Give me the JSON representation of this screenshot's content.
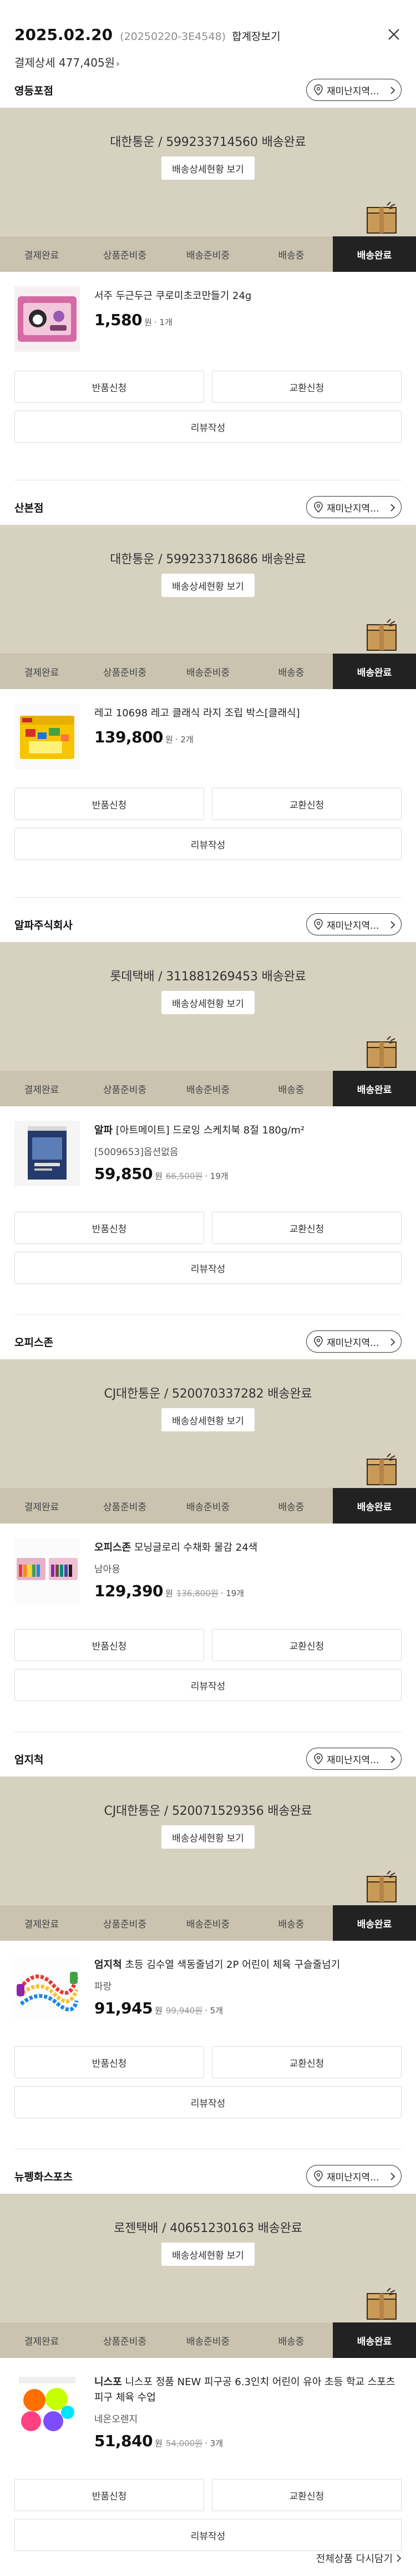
{
  "header": {
    "date": "2025.02.20",
    "order_id": "(20250220-3E4548)",
    "combined_label": "합계장보기",
    "total": "결제상세 477,405원"
  },
  "steps": [
    "결제완료",
    "상품준비중",
    "배송준비중",
    "배송중",
    "배송완료"
  ],
  "pickup_label": "재미난지역...",
  "tracking_button": "배송상세현황 보기",
  "actions": {
    "return": "반품신청",
    "exchange": "교환신청",
    "review": "리뷰작성"
  },
  "won": "원",
  "orders": [
    {
      "store": "영등포점",
      "courier": "대한통운 / 599233714560 배송완료",
      "brand": "",
      "name": "서주 두근두근 쿠로미초코만들기 24g",
      "option": "",
      "price": "1,580",
      "original_price": "",
      "qty": "· 1개"
    },
    {
      "store": "산본점",
      "courier": "대한통운 / 599233718686 배송완료",
      "brand": "",
      "name": "레고 10698 레고 클래식 라지 조립 박스[클래식]",
      "option": "",
      "price": "139,800",
      "original_price": "",
      "qty": "· 2개"
    },
    {
      "store": "알파주식회사",
      "courier": "롯데택배 / 311881269453 배송완료",
      "brand": "알파",
      "name": "[아트메이트] 드로잉 스케치북 8절 180g/m²",
      "option": "[5009653]옵션없음",
      "price": "59,850",
      "original_price": "66,500원",
      "qty": "· 19개"
    },
    {
      "store": "오피스존",
      "courier": "CJ대한통운 / 520070337282 배송완료",
      "brand": "오피스존",
      "name": "모닝글로리 수채화 물감 24색",
      "option": "남아용",
      "price": "129,390",
      "original_price": "136,800원",
      "qty": "· 19개"
    },
    {
      "store": "엄지척",
      "courier": "CJ대한통운 / 520071529356 배송완료",
      "brand": "엄지척",
      "name": "초등 김수열 색동줄넘기 2P 어린이 체육 구슬줄넘기",
      "option": "파랑",
      "price": "91,945",
      "original_price": "99,940원",
      "qty": "· 5개"
    },
    {
      "store": "뉴펭화스포츠",
      "courier": "로젠택배 / 40651230163 배송완료",
      "brand": "니스포",
      "name": "니스포 정품 NEW 피구공 6.3인치 어린이 유아 초등 학교 스포츠 피구 체육 수업",
      "option": "네온오렌지",
      "price": "51,840",
      "original_price": "54,000원",
      "qty": "· 3개"
    }
  ],
  "footer": {
    "reorder_all": "전체상품 다시담기"
  },
  "colors": {
    "banner": "#d7d2c0",
    "active_step": "#222222"
  }
}
